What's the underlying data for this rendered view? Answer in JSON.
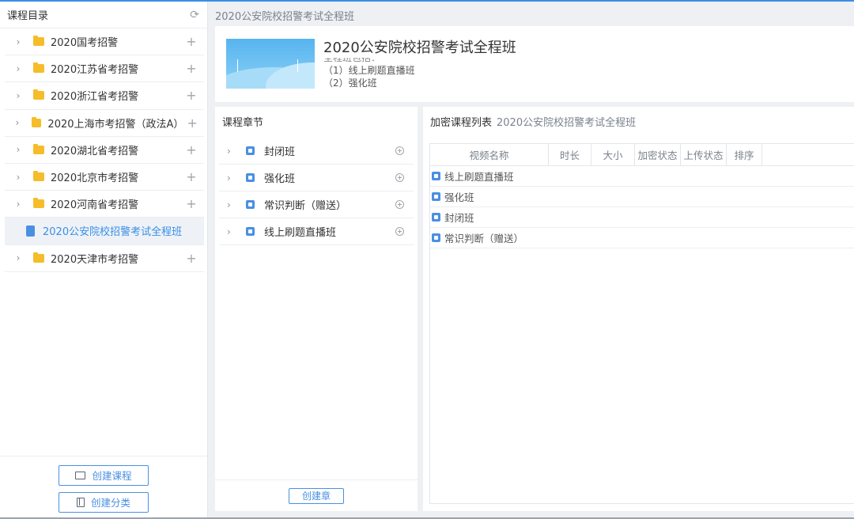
{
  "colors": {
    "accent": "#4a90e2",
    "folder": "#f5bd2a",
    "active_bg": "#eef2f7"
  },
  "sidebar": {
    "title": "课程目录",
    "items": [
      {
        "label": "2020国考招警",
        "type": "folder"
      },
      {
        "label": "2020江苏省考招警",
        "type": "folder"
      },
      {
        "label": "2020浙江省考招警",
        "type": "folder"
      },
      {
        "label": "2020上海市考招警（政法A）",
        "type": "folder"
      },
      {
        "label": "2020湖北省考招警",
        "type": "folder"
      },
      {
        "label": "2020北京市考招警",
        "type": "folder"
      },
      {
        "label": "2020河南省考招警",
        "type": "folder"
      },
      {
        "label": "2020公安院校招警考试全程班",
        "type": "course",
        "active": true
      },
      {
        "label": "2020天津市考招警",
        "type": "folder"
      }
    ],
    "create_course": "创建课程",
    "create_category": "创建分类"
  },
  "breadcrumb": "2020公安院校招警考试全程班",
  "course": {
    "title": "2020公安院校招警考试全程班",
    "desc_cut": "全程班包括：",
    "desc_line1": "（1）线上刷题直播班",
    "desc_line2": "（2）强化班"
  },
  "chapters": {
    "title": "课程章节",
    "items": [
      "封闭班",
      "强化班",
      "常识判断（赠送）",
      "线上刷题直播班"
    ],
    "create_button": "创建章"
  },
  "videos": {
    "title": "加密课程列表",
    "subtitle": "2020公安院校招警考试全程班",
    "columns": [
      "视频名称",
      "时长",
      "大小",
      "加密状态",
      "上传状态",
      "排序"
    ],
    "rows": [
      "线上刷题直播班",
      "强化班",
      "封闭班",
      "常识判断（赠送）"
    ]
  }
}
